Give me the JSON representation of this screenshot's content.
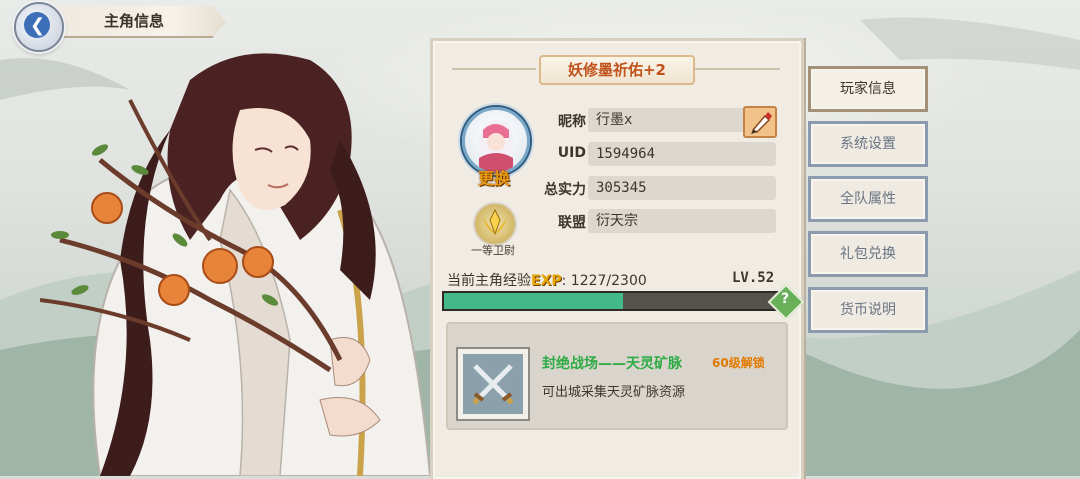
{
  "header": {
    "title": "主角信息",
    "back_icon": "back-arrow-icon"
  },
  "character": {
    "title_name": "妖修墨祈佑+2",
    "avatar_icon": "avatar-portrait-icon",
    "change_label": "更换",
    "rank_label": "一等卫尉",
    "rank_icon": "rank-emblem-icon"
  },
  "profile": {
    "nickname_label": "昵称",
    "nickname_value": "行墨x",
    "uid_label": "UID",
    "uid_value": "1594964",
    "power_label": "总实力",
    "power_value": "305345",
    "guild_label": "联盟",
    "guild_value": "衍天宗",
    "edit_icon": "brush-edit-icon"
  },
  "experience": {
    "label_prefix": "当前主角经验",
    "exp_tag": "EXP",
    "value_text": ": 1227/2300",
    "level_text": "LV.52",
    "current": 1227,
    "max": 2300,
    "help_icon": "question-icon"
  },
  "feature": {
    "icon": "crossed-swords-icon",
    "title": "封绝战场——天灵矿脉",
    "lock_text": "60级解锁",
    "description": "可出城采集天灵矿脉资源"
  },
  "tabs": [
    {
      "label": "玩家信息",
      "active": true
    },
    {
      "label": "系统设置",
      "active": false
    },
    {
      "label": "全队属性",
      "active": false
    },
    {
      "label": "礼包兑换",
      "active": false
    },
    {
      "label": "货币说明",
      "active": false
    }
  ],
  "colors": {
    "exp_fill": "#43b88a",
    "title_orange": "#c0521c",
    "feature_green": "#2dab45",
    "lock_orange": "#e07a00"
  }
}
